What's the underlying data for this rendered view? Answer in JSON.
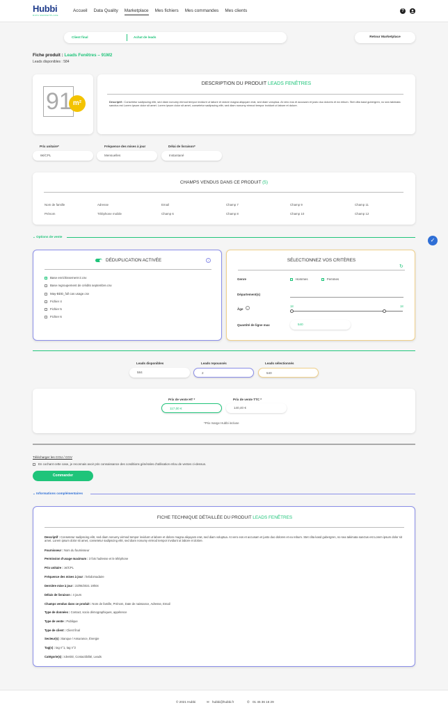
{
  "header": {
    "logo": "Hubbi",
    "logo_sub": "DATA MARKETPLACE",
    "nav": [
      "Accueil",
      "Data Quality",
      "Marketplace",
      "Mes fichiers",
      "Mes commandes",
      "Mes clients"
    ],
    "help_icon": "help-icon",
    "user_icon": "user-icon"
  },
  "tabs": {
    "client_final": "Client final",
    "achat_leads": "Achat de leads"
  },
  "retour_button": "Retour Marketplace",
  "product": {
    "title_prefix": "Fiche produit :",
    "title_name": "Leads Fenêtres – 91M2",
    "available": "Leads disponibles : 584",
    "logo_text": "91",
    "logo_badge": "m²"
  },
  "description": {
    "title_prefix": "DESCRIPTION DU PRODUIT",
    "title_accent": "LEADS FENÊTRES",
    "label": "Descriptif :",
    "text": "Consetetur sadipscing elitr, sed diam nonumy eirmod tempor invidunt ut labore et dolore magna aliquyam erat, sed diam voluptua. At vero eos et accusam et justo duo dolores et ea rebum. Stet clita kasd gubergren, no sea takimata sanctus est Lorem ipsum dolor sit amet. Lorem ipsum dolor sit amet, consetetur sadipscing elitr, sed diam nonumy eirmod tempor invidunt ut labore et dolore."
  },
  "info_fields": {
    "prix_label": "Prix unitaire*",
    "prix_value": "6€/CPL",
    "freq_label": "Fréquence des mises à jour",
    "freq_value": "Mensuelles",
    "delai_label": "Délai de livraison*",
    "delai_value": "Instantané"
  },
  "champs": {
    "title_prefix": "CHAMPS VENDUS DANS CE PRODUIT",
    "title_count": "(5)",
    "row1": [
      "Nom de famille",
      "Adresse",
      "Email",
      "Champ 7",
      "Champ 9",
      "Champ 11"
    ],
    "row2": [
      "Prénom",
      "Téléphone mobile",
      "Champ 6",
      "Champ 8",
      "Champ 10",
      "Champ 12"
    ]
  },
  "options_vente": "Options de vente",
  "dedup": {
    "title": "DÉDUPLICATION ACTIVÉE",
    "files": [
      "Base enrichissement-2.csv",
      "Base regroupement de crédits septembre.csv",
      "May-BDD_full cas usage.csv",
      "Fichier 4",
      "Fichier 5",
      "Fichier 6"
    ]
  },
  "criteres": {
    "title": "SÉLECTIONNEZ VOS CRITÈRES",
    "genre_label": "Genre",
    "hommes": "Hommes",
    "femmes": "Femmes",
    "dept_label": "Département(s)",
    "age_label": "Âge",
    "age_min": "18",
    "age_max": "18",
    "age_range": [
      0.0,
      0.83
    ],
    "qty_label": "Quantité de ligne max",
    "qty_value": "540"
  },
  "counts": {
    "dispo_label": "Leads disponibles",
    "dispo_value": "584",
    "repousses_label": "Leads repoussés",
    "repousses_value": "2",
    "selec_label": "Leads sélectionnés",
    "selec_value": "540"
  },
  "prices": {
    "ht_label": "Prix de vente HT *",
    "ht_value": "117,00 €",
    "ttc_label": "Prix de vente TTC *",
    "ttc_value": "140,40 €",
    "note": "*Prix marge Hubbi incluse"
  },
  "cgu": {
    "link": "Télécharger les CGU / CGV",
    "text": "En cochant cette case, je reconnais avoir pris connaissance des conditions générales d'utilisation et/ou de ventes ci-dessus.",
    "button": "Commander"
  },
  "infos_comp": "Informations complémentaires",
  "fiche": {
    "title_prefix": "FICHE TECHNIQUE DÉTAILLÉE DU PRODUIT",
    "title_accent": "LEADS FENÊTRES",
    "rows": [
      {
        "k": "Descriptif :",
        "v": "Consetetur sadipscing elitr, sed diam nonumy eirmod tempor invidunt ut labore et dolore magna aliquyam erat, sed diam voluptua. At vero eos et accusam et justo duo dolores et ea rebum. Stet clita kasd gubergren, no sea takimata sanctus est Lorem ipsum dolor sit amet. Lorem ipsum dolor sit amet, consetetur sadipscing elitr, sed diam nonumy eirmod tempor invidunt ut labore et dolore."
      },
      {
        "k": "Fournisseur :",
        "v": "Nom du fournisseur"
      },
      {
        "k": "Permission d'usage maximum :",
        "v": "3 fois l'adresse et le téléphone"
      },
      {
        "k": "Prix unitaire :",
        "v": "1€/CPL"
      },
      {
        "k": "Fréquence des mises à jour :",
        "v": "hebdomadaire"
      },
      {
        "k": "Dernière mise à jour :",
        "v": "23/06/2021 19h04"
      },
      {
        "k": "Délais de livraison :",
        "v": "4 jours"
      },
      {
        "k": "Champs vendus dans ce produit :",
        "v": "Nom de famille, Prénom, Date de naissance, Adresse, Email"
      },
      {
        "k": "Type de données :",
        "v": "Contact, socio démographiques, appétence"
      },
      {
        "k": "Type de vente :",
        "v": "Publique"
      },
      {
        "k": "Type de client :",
        "v": "Client final"
      },
      {
        "k": "Secteur(s) :",
        "v": "Banque / Assurance, Énergie"
      },
      {
        "k": "Tag(s) :",
        "v": "tag n°1, tag n°2"
      },
      {
        "k": "Catégorie(s) :",
        "v": "Identité, Contactibilité, Leads"
      }
    ]
  },
  "footer": {
    "copyright": "© 2021 Hubbi",
    "email": "hubbi@hubbi.fr",
    "phone": "01 45 36 16 29"
  },
  "colors": {
    "accent": "#1fc47a",
    "brand": "#1d3a8a",
    "purple": "#8a8ee8",
    "orange": "#f0d08a"
  }
}
